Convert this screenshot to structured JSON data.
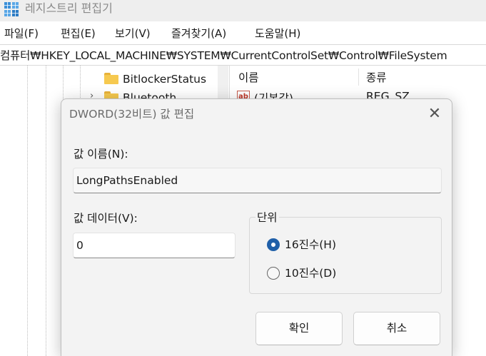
{
  "window": {
    "title": "레지스트리 편집기"
  },
  "menu": [
    "파일(F)",
    "편집(E)",
    "보기(V)",
    "즐겨찾기(A)",
    "도움말(H)"
  ],
  "address": "컴퓨터₩HKEY_LOCAL_MACHINE₩SYSTEM₩CurrentControlSet₩Control₩FileSystem",
  "tree": {
    "items": [
      "BitlockerStatus",
      "Bluetooth"
    ]
  },
  "list": {
    "headers": [
      "이름",
      "종류"
    ],
    "rows": [
      {
        "name": "(기본값)",
        "type": "REG_SZ"
      }
    ]
  },
  "dialog": {
    "title": "DWORD(32비트) 값 편집",
    "value_name_label": "값 이름(N):",
    "value_name": "LongPathsEnabled",
    "value_data_label": "값 데이터(V):",
    "value_data": "0",
    "base_group_label": "단위",
    "radio_hex": "16진수(H)",
    "radio_dec": "10진수(D)",
    "selected_base": "hex",
    "ok_label": "확인",
    "cancel_label": "취소",
    "close_glyph": "✕"
  },
  "colors": {
    "accent": "#1f5fa8",
    "folder": "#f6c94f"
  }
}
